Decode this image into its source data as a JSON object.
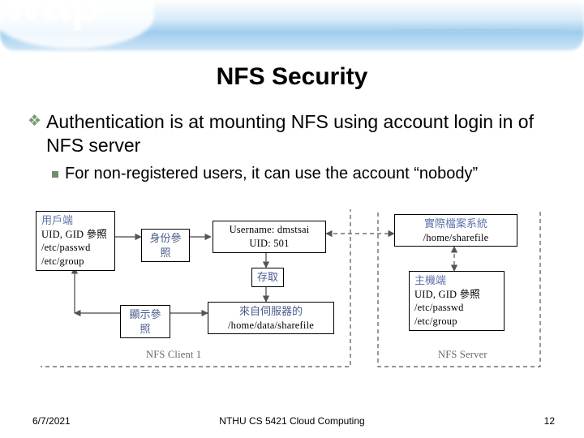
{
  "decor": {
    "wap_text": "wap"
  },
  "title": "NFS Security",
  "bullets": {
    "b1": "Authentication is at mounting NFS using account login in of NFS server",
    "b2": "For non-registered users, it can use the account “nobody”"
  },
  "diagram": {
    "client_hdr": "用戶端",
    "client_l1": "UID, GID 參照",
    "client_l2": "/etc/passwd",
    "client_l3": "/etc/group",
    "id_ref": "身份參照",
    "user_l1": "Username: dmstsai",
    "user_l2": "UID: 501",
    "access": "存取",
    "display_ref": "顯示參照",
    "from_server_l1": "來自伺服器的",
    "from_server_l2": "/home/data/sharefile",
    "nfs_client": "NFS Client 1",
    "filesys_hdr": "實際檔案系統",
    "filesys_l1": "/home/sharefile",
    "host_hdr": "主機端",
    "host_l1": "UID, GID 參照",
    "host_l2": "/etc/passwd",
    "host_l3": "/etc/group",
    "nfs_server": "NFS Server"
  },
  "footer": {
    "date": "6/7/2021",
    "course": "NTHU CS 5421 Cloud Computing",
    "pageno": "12"
  }
}
